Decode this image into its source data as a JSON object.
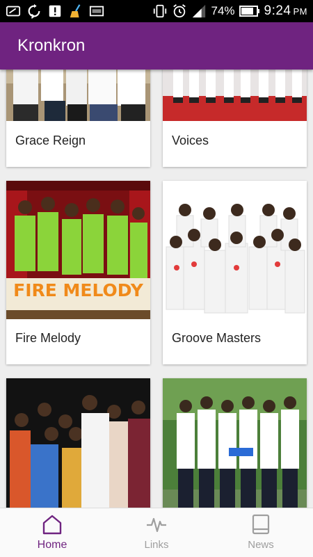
{
  "status_bar": {
    "battery_percent": "74%",
    "time": "9:24",
    "ampm": "PM",
    "icons": [
      "screen-cast-icon",
      "sync-icon",
      "alert-icon",
      "broom-icon",
      "image-icon",
      "vibrate-icon",
      "alarm-icon",
      "signal-icon",
      "battery-icon"
    ]
  },
  "app_bar": {
    "title": "Kronkron"
  },
  "cards": [
    {
      "title": "Grace Reign"
    },
    {
      "title": "Voices"
    },
    {
      "title": "Fire Melody",
      "banner": "FIRE MELODY"
    },
    {
      "title": "Groove Masters"
    },
    {
      "title": ""
    },
    {
      "title": ""
    }
  ],
  "bottom_nav": {
    "items": [
      {
        "label": "Home",
        "icon": "home-icon",
        "active": true
      },
      {
        "label": "Links",
        "icon": "pulse-icon",
        "active": false
      },
      {
        "label": "News",
        "icon": "book-icon",
        "active": false
      }
    ]
  },
  "colors": {
    "primary": "#6f2380",
    "status_bar": "#000000",
    "inactive": "#9e9e9e"
  }
}
